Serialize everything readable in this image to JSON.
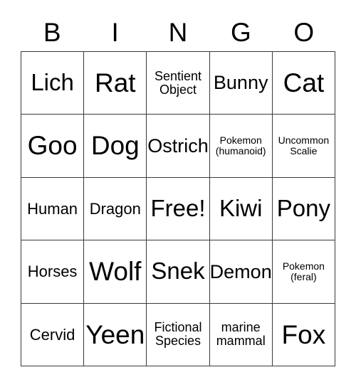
{
  "card": {
    "headers": [
      "B",
      "I",
      "N",
      "G",
      "O"
    ],
    "rows": [
      [
        {
          "label": "Lich",
          "size": "lg"
        },
        {
          "label": "Rat",
          "size": "xl"
        },
        {
          "label": "Sentient\nObject",
          "size": "xs"
        },
        {
          "label": "Bunny",
          "size": "md"
        },
        {
          "label": "Cat",
          "size": "xl"
        }
      ],
      [
        {
          "label": "Goo",
          "size": "xl"
        },
        {
          "label": "Dog",
          "size": "xl"
        },
        {
          "label": "Ostrich",
          "size": "md"
        },
        {
          "label": "Pokemon\n(humanoid)",
          "size": "xxs"
        },
        {
          "label": "Uncommon\nScalie",
          "size": "xxs"
        }
      ],
      [
        {
          "label": "Human",
          "size": "sm"
        },
        {
          "label": "Dragon",
          "size": "sm"
        },
        {
          "label": "Free!",
          "size": "lg"
        },
        {
          "label": "Kiwi",
          "size": "lg"
        },
        {
          "label": "Pony",
          "size": "lg"
        }
      ],
      [
        {
          "label": "Horses",
          "size": "sm"
        },
        {
          "label": "Wolf",
          "size": "xl"
        },
        {
          "label": "Snek",
          "size": "lg"
        },
        {
          "label": "Demon",
          "size": "md"
        },
        {
          "label": "Pokemon\n(feral)",
          "size": "xxs"
        }
      ],
      [
        {
          "label": "Cervid",
          "size": "sm"
        },
        {
          "label": "Yeen",
          "size": "xl"
        },
        {
          "label": "Fictional\nSpecies",
          "size": "xs"
        },
        {
          "label": "marine\nmammal",
          "size": "xs"
        },
        {
          "label": "Fox",
          "size": "xl"
        }
      ]
    ],
    "free_space": {
      "row": 2,
      "col": 2,
      "label": "Free!"
    },
    "colors": {
      "background": "#ffffff",
      "cell_background": "#ffffff",
      "border": "#3a3a3a",
      "text": "#000000"
    }
  }
}
